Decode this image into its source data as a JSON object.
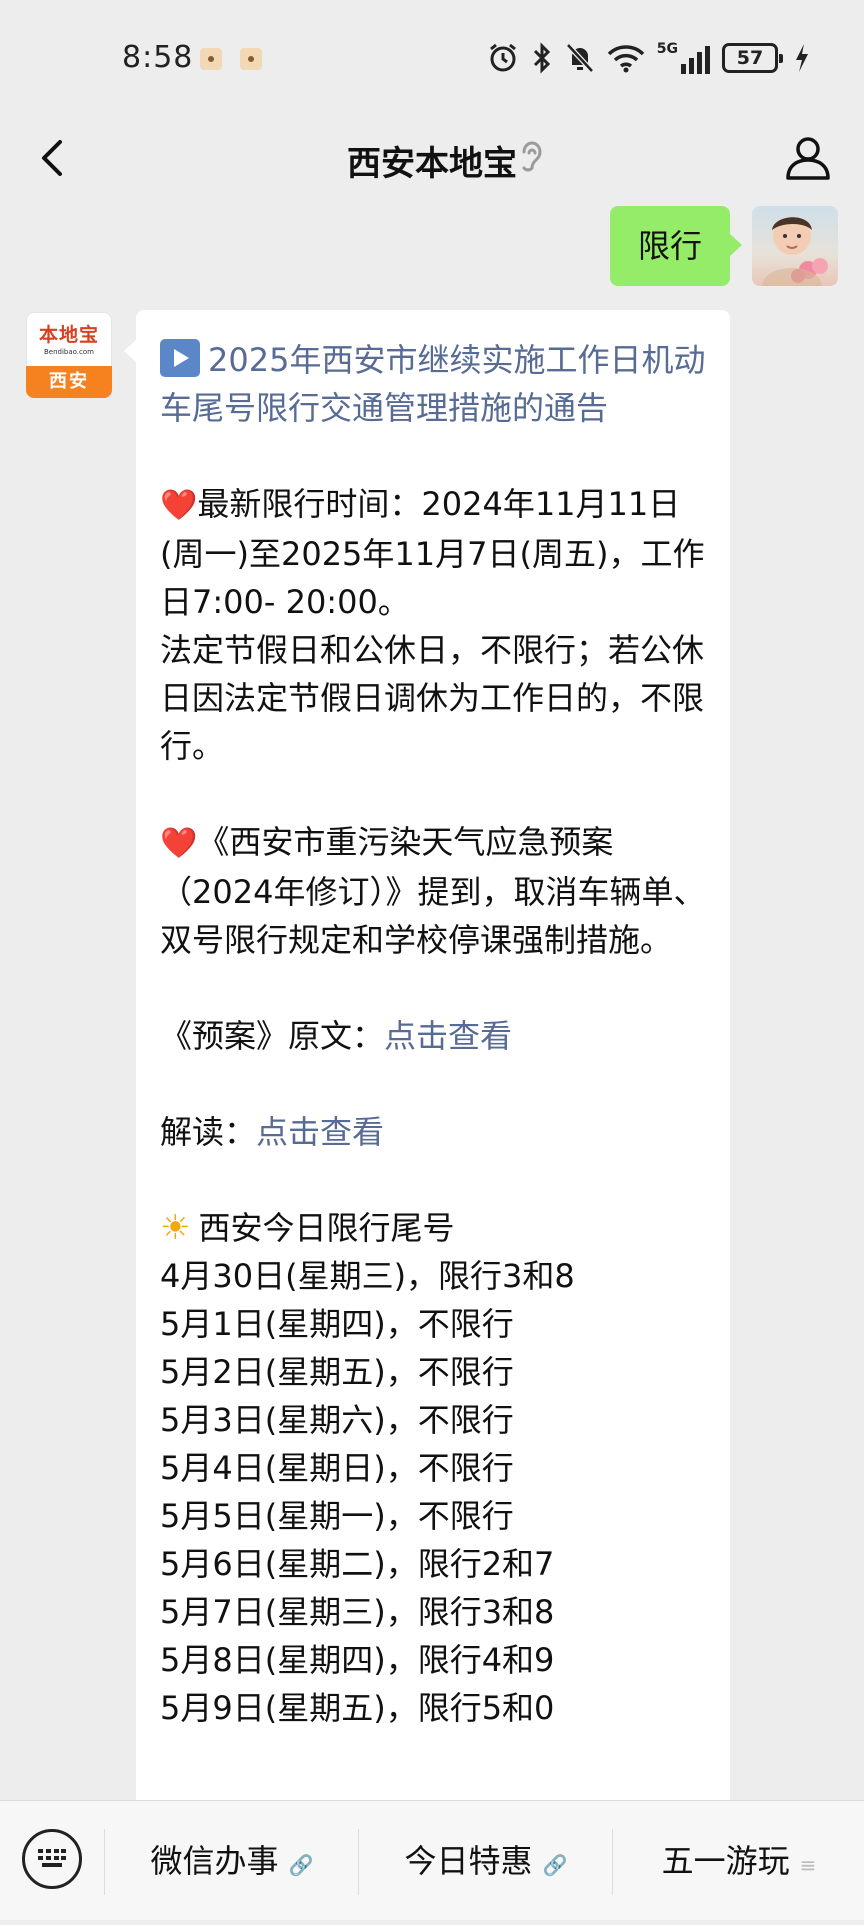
{
  "status_bar": {
    "time": "8:58",
    "network": "5G",
    "battery": "57"
  },
  "nav": {
    "title": "西安本地宝"
  },
  "chat": {
    "outgoing": {
      "text": "限行"
    },
    "bot_avatar": {
      "logo_text": "本地宝",
      "logo_url": "Bendibao.com",
      "city": "西安"
    },
    "reply": {
      "headline": "2025年西安市继续实施工作日机动车尾号限行交通管理措施的通告",
      "time_label": "最新限行时间：",
      "time_range": "2024年11月11日(周一)至2025年11月7日(周五)，工作日7:00- 20:00。",
      "holiday_rule": "法定节假日和公休日，不限行；若公休日因法定节假日调休为工作日的，不限行。",
      "plan_note": "《西安市重污染天气应急预案（2024年修订）》提到，取消车辆单、双号限行规定和学校停课强制措施。",
      "plan_label": "《预案》原文：",
      "plan_link": "点击查看",
      "interp_label": "解读：",
      "interp_link": "点击查看",
      "today_title": "西安今日限行尾号",
      "schedule": [
        "4月30日(星期三)，限行3和8",
        "5月1日(星期四)，不限行",
        "5月2日(星期五)，不限行",
        "5月3日(星期六)，不限行",
        "5月4日(星期日)，不限行",
        "5月5日(星期一)，不限行",
        "5月6日(星期二)，限行2和7",
        "5月7日(星期三)，限行3和8",
        "5月8日(星期四)，限行4和9",
        "5月9日(星期五)，限行5和0"
      ]
    }
  },
  "bottom_menu": {
    "items": [
      {
        "label": "微信办事"
      },
      {
        "label": "今日特惠"
      },
      {
        "label": "五一游玩"
      }
    ]
  },
  "colors": {
    "background": "#ededed",
    "outgoing_bubble": "#95ec69",
    "link": "#576b95",
    "heart": "#e0172a",
    "logo_orange": "#f5821f"
  }
}
